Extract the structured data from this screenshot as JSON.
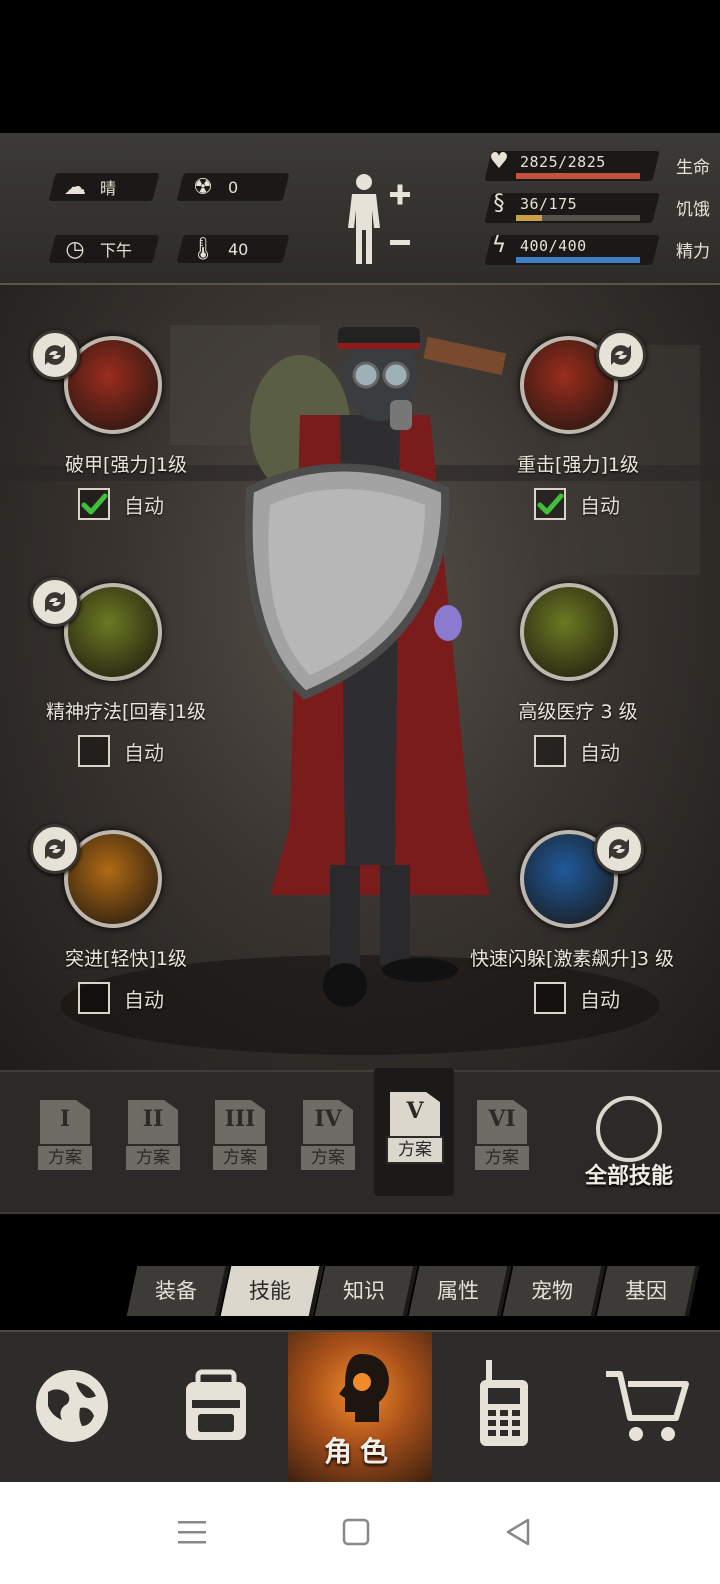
{
  "status": {
    "weather": {
      "icon": "cloud-sun-icon",
      "value": "晴"
    },
    "radiation": {
      "icon": "radiation-icon",
      "value": "0"
    },
    "time": {
      "icon": "clock-icon",
      "value": "下午"
    },
    "temperature": {
      "icon": "thermometer-icon",
      "value": "40"
    },
    "bars": [
      {
        "icon": "heart-icon",
        "value": "2825/2825",
        "label": "生命",
        "current": 2825,
        "max": 2825,
        "color": "#c4523d"
      },
      {
        "icon": "stomach-icon",
        "value": "36/175",
        "label": "饥饿",
        "current": 36,
        "max": 175,
        "color": "#c8a046"
      },
      {
        "icon": "energy-icon",
        "value": "400/400",
        "label": "精力",
        "current": 400,
        "max": 400,
        "color": "#3f7fc4"
      }
    ]
  },
  "skills": [
    {
      "name": "破甲[强力]1级",
      "auto_label": "自动",
      "auto": true,
      "icon": "skull-crossbones-icon",
      "color": "#9b2d1d",
      "swappable": true
    },
    {
      "name": "重击[强力]1级",
      "auto_label": "自动",
      "auto": true,
      "icon": "axe-strike-icon",
      "color": "#9b2d1d",
      "swappable": true
    },
    {
      "name": "精神疗法[回春]1级",
      "auto_label": "自动",
      "auto": false,
      "icon": "spirit-heal-icon",
      "color": "#6b7a22",
      "swappable": true
    },
    {
      "name": "高级医疗 3 级",
      "auto_label": "自动",
      "auto": false,
      "icon": "medkit-icon",
      "color": "#6b7a22",
      "swappable": false
    },
    {
      "name": "突进[轻快]1级",
      "auto_label": "自动",
      "auto": false,
      "icon": "dash-hourglass-icon",
      "color": "#b06a14",
      "swappable": true
    },
    {
      "name": "快速闪躲[激素飙升]3 级",
      "auto_label": "自动",
      "auto": false,
      "icon": "dodge-icon",
      "color": "#1f5a9b",
      "swappable": true
    }
  ],
  "plans": {
    "tag": "方案",
    "items": [
      {
        "numeral": "I",
        "active": false
      },
      {
        "numeral": "II",
        "active": false
      },
      {
        "numeral": "III",
        "active": false
      },
      {
        "numeral": "IV",
        "active": false
      },
      {
        "numeral": "V",
        "active": true
      },
      {
        "numeral": "VI",
        "active": false
      }
    ],
    "all_skills_label": "全部技能"
  },
  "tabs": [
    {
      "label": "装备",
      "active": false
    },
    {
      "label": "技能",
      "active": true
    },
    {
      "label": "知识",
      "active": false
    },
    {
      "label": "属性",
      "active": false
    },
    {
      "label": "宠物",
      "active": false
    },
    {
      "label": "基因",
      "active": false
    }
  ],
  "bottom_nav": [
    {
      "icon": "globe-icon",
      "label": ""
    },
    {
      "icon": "backpack-icon",
      "label": ""
    },
    {
      "icon": "character-head-icon",
      "label": "角色",
      "active": true
    },
    {
      "icon": "walkie-talkie-icon",
      "label": ""
    },
    {
      "icon": "cart-icon",
      "label": ""
    }
  ]
}
